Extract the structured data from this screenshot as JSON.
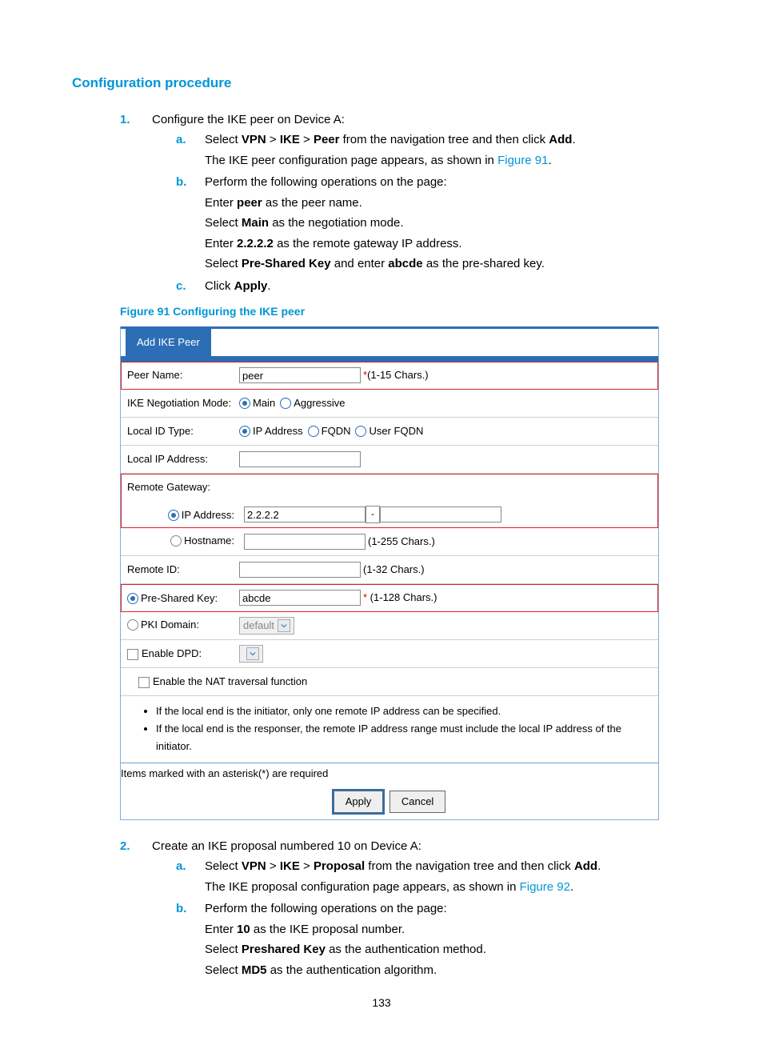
{
  "page_number": "133",
  "heading": "Configuration procedure",
  "step1": {
    "num": "1.",
    "text": "Configure the IKE peer on Device A:",
    "a": {
      "m": "a.",
      "l1a": "Select ",
      "vpn": "VPN",
      "g1": " > ",
      "ike": "IKE",
      "g2": " > ",
      "peer": "Peer",
      "l1b": " from the navigation tree and then click ",
      "add": "Add",
      "dot": ".",
      "l2a": "The IKE peer configuration page appears, as shown in ",
      "figref": "Figure 91",
      "l2b": "."
    },
    "b": {
      "m": "b.",
      "l1": "Perform the following operations on the page:",
      "l2a": "Enter ",
      "peerb": "peer",
      "l2b": " as the peer name.",
      "l3a": "Select ",
      "mainb": "Main",
      "l3b": " as the negotiation mode.",
      "l4a": "Enter ",
      "ipb": "2.2.2.2",
      "l4b": " as the remote gateway IP address.",
      "l5a": "Select ",
      "pskb": "Pre-Shared Key",
      "l5b": " and enter ",
      "abcdeb": "abcde",
      "l5c": " as the pre-shared key."
    },
    "c": {
      "m": "c.",
      "l1a": "Click ",
      "apply": "Apply",
      "dot": "."
    }
  },
  "figure": {
    "caption": "Figure 91 Configuring the IKE peer",
    "tab": "Add IKE Peer",
    "rows": {
      "peername_lbl": "Peer Name:",
      "peername_val": "peer",
      "peername_hint": "*(1-15 Chars.)",
      "negmode_lbl": "IKE Negotiation Mode:",
      "negmode_main": "Main",
      "negmode_aggr": "Aggressive",
      "localid_lbl": "Local ID Type:",
      "localid_ip": "IP Address",
      "localid_fqdn": "FQDN",
      "localid_ufqdn": "User FQDN",
      "localip_lbl": "Local IP Address:",
      "remgw_lbl": "Remote Gateway:",
      "remgw_ip_lbl": "IP Address:",
      "remgw_ip_val": "2.2.2.2",
      "remgw_host_lbl": "Hostname:",
      "remgw_host_hint": "(1-255 Chars.)",
      "remid_lbl": "Remote ID:",
      "remid_hint": "(1-32 Chars.)",
      "psk_lbl": "Pre-Shared Key:",
      "psk_val": "abcde",
      "psk_hint": "* (1-128 Chars.)",
      "pki_lbl": "PKI Domain:",
      "pki_sel": "default",
      "dpd_lbl": "Enable DPD:",
      "nat_lbl": "Enable the NAT traversal function"
    },
    "notes": {
      "n1": "If the local end is the initiator, only one remote IP address can be specified.",
      "n2": "If the local end is the responser, the remote IP address range must include the local IP address of the initiator."
    },
    "req": "Items marked with an asterisk(*) are required",
    "btn_apply": "Apply",
    "btn_cancel": "Cancel"
  },
  "step2": {
    "num": "2.",
    "text": "Create an IKE proposal numbered 10 on Device A:",
    "a": {
      "m": "a.",
      "l1a": "Select ",
      "vpn": "VPN",
      "g1": " > ",
      "ike": "IKE",
      "g2": " > ",
      "prop": "Proposal",
      "l1b": " from the navigation tree and then click ",
      "add": "Add",
      "dot": ".",
      "l2a": "The IKE proposal configuration page appears, as shown in ",
      "figref": "Figure 92",
      "l2b": "."
    },
    "b": {
      "m": "b.",
      "l1": "Perform the following operations on the page:",
      "l2a": "Enter ",
      "tenb": "10",
      "l2b": " as the IKE proposal number.",
      "l3a": "Select ",
      "pskb": "Preshared Key",
      "l3b": " as the authentication method.",
      "l4a": "Select ",
      "md5b": "MD5",
      "l4b": " as the authentication algorithm."
    }
  }
}
